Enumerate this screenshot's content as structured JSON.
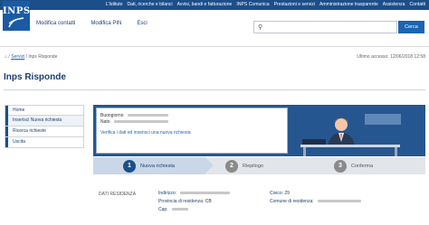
{
  "header": {
    "logo_text": "INPS",
    "top_links": [
      "L'Istituto",
      "Dati, ricerche e bilanci",
      "Avvisi, bandi e fatturazione",
      "INPS Comunica",
      "Prestazioni e servizi",
      "Amministrazione trasparente",
      "Assistenza",
      "Contatti"
    ],
    "nav": [
      "Modifica contatti",
      "Modifica PIN",
      "Esci"
    ],
    "search_button": "Cerca",
    "search_placeholder": ""
  },
  "breadcrumb": {
    "sep": "/",
    "link": "Servizi",
    "current": "Inps Risponde"
  },
  "last_access": "Ultimo accesso: 12/06/2018 12:58",
  "page_title": "Inps Risponde",
  "sidebar": {
    "items": [
      {
        "label": "Home"
      },
      {
        "label": "Inserisci Nuova richiesta"
      },
      {
        "label": "Ricerca richieste"
      },
      {
        "label": "Uscita"
      }
    ]
  },
  "hero": {
    "line1_label": "Buongiorno",
    "line2_label": "Nato",
    "line3": "Verifica i dati ed inserisci una nuova richiesta"
  },
  "steps": [
    {
      "num": "1",
      "label": "Nuova richiesta"
    },
    {
      "num": "2",
      "label": "Riepilogo"
    },
    {
      "num": "3",
      "label": "Conferma"
    }
  ],
  "residence": {
    "section_label": "DATI RESIDENZA",
    "left": [
      {
        "key": "Indirizzo:",
        "value": ""
      },
      {
        "key": "Provincia di residenza:",
        "value": "CB"
      },
      {
        "key": "Cap:",
        "value": ""
      }
    ],
    "right": [
      {
        "key": "Civico:",
        "value": "29"
      },
      {
        "key": "Comune di residenza:",
        "value": ""
      }
    ]
  },
  "colors": {
    "brand_blue": "#1b4f8a",
    "button_blue": "#1b65b1",
    "hero_blue": "#26568f"
  }
}
